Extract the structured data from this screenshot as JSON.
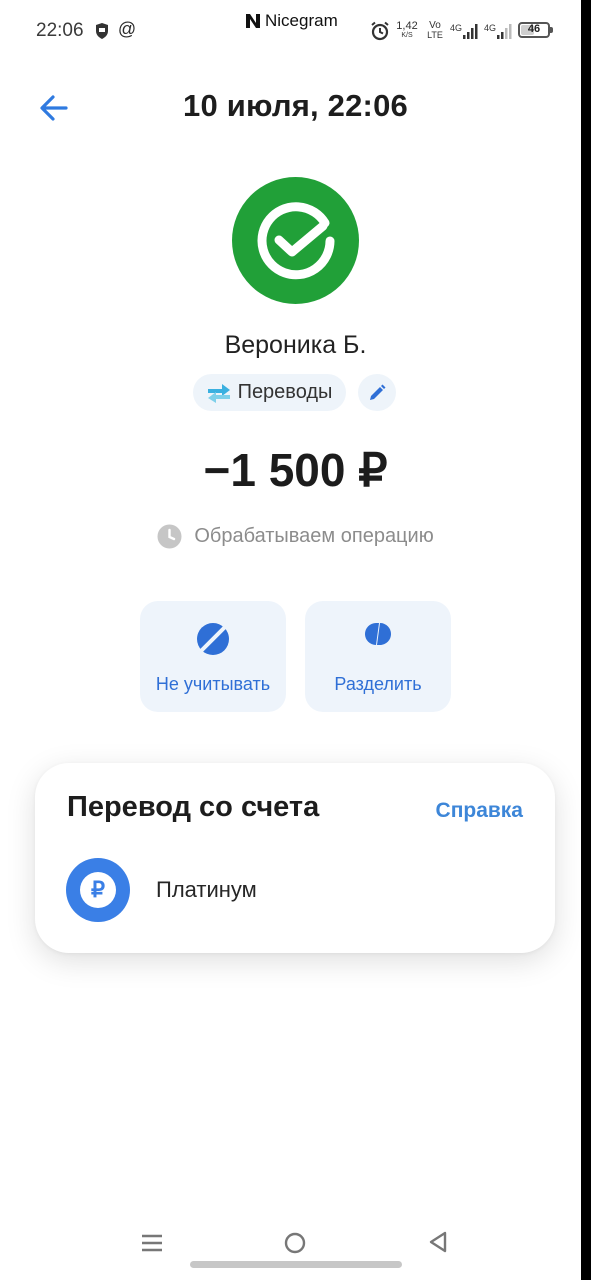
{
  "status_bar": {
    "time": "22:06",
    "app_name": "Nicegram",
    "net_speed_value": "1,42",
    "net_speed_unit": "K/S",
    "volte_top": "Vo",
    "volte_bottom": "LTE",
    "battery": "46",
    "icons": [
      "shield-icon",
      "at-icon",
      "alarm-icon",
      "signal-4g-icon",
      "signal-4g-icon"
    ]
  },
  "header": {
    "title": "10 июля, 22:06",
    "back_icon": "arrow-left-icon"
  },
  "transaction": {
    "recipient": "Вероника Б.",
    "category": "Переводы",
    "amount": "−1 500 ₽",
    "status": "Обрабатываем операцию",
    "logo_color": "#21a038"
  },
  "actions": [
    {
      "label": "Не учитывать",
      "icon": "eye-off-icon"
    },
    {
      "label": "Разделить",
      "icon": "split-icon"
    }
  ],
  "source_card": {
    "title": "Перевод со счета",
    "help_label": "Справка",
    "account_name": "Платинум",
    "account_icon_symbol": "₽"
  },
  "colors": {
    "accent": "#2f6fd6",
    "link": "#3d86d8",
    "brand_green": "#21a038"
  }
}
